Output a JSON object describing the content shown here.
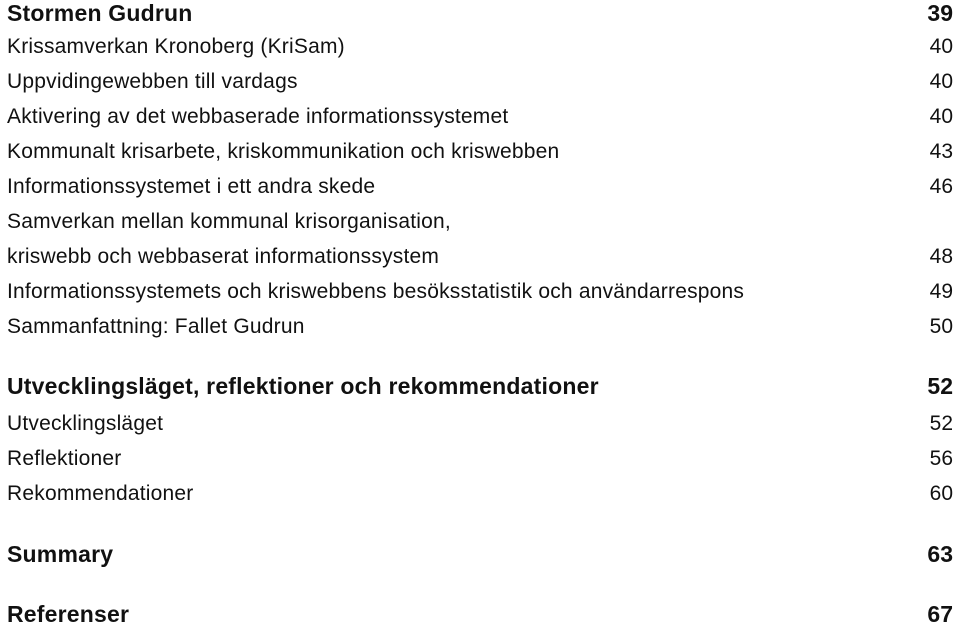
{
  "toc": {
    "entries": [
      {
        "title": "Stormen Gudrun",
        "page": "39",
        "level": "section"
      },
      {
        "title": "Krissamverkan Kronoberg (KriSam)",
        "page": "40",
        "level": "sub"
      },
      {
        "title": "Uppvidingewebben till vardags",
        "page": "40",
        "level": "sub"
      },
      {
        "title": "Aktivering av det webbaserade informationssystemet",
        "page": "40",
        "level": "sub"
      },
      {
        "title": "Kommunalt krisarbete, kriskommunikation och kriswebben",
        "page": "43",
        "level": "sub"
      },
      {
        "title": "Informationssystemet i ett andra skede",
        "page": "46",
        "level": "sub"
      },
      {
        "title": "Samverkan mellan kommunal krisorganisation,",
        "page": "",
        "level": "sub"
      },
      {
        "title": "kriswebb och webbaserat informationssystem",
        "page": "48",
        "level": "sub"
      },
      {
        "title": "Informationssystemets och kriswebbens besöksstatistik och användarrespons",
        "page": "49",
        "level": "sub"
      },
      {
        "title": "Sammanfattning: Fallet Gudrun",
        "page": "50",
        "level": "sub"
      },
      {
        "title": "Utvecklingsläget, reflektioner och rekommendationer",
        "page": "52",
        "level": "section"
      },
      {
        "title": "Utvecklingsläget",
        "page": "52",
        "level": "sub"
      },
      {
        "title": "Reflektioner",
        "page": "56",
        "level": "sub"
      },
      {
        "title": "Rekommendationer",
        "page": "60",
        "level": "sub"
      },
      {
        "title": "Summary",
        "page": "63",
        "level": "section"
      },
      {
        "title": "Referenser",
        "page": "67",
        "level": "section"
      }
    ]
  }
}
